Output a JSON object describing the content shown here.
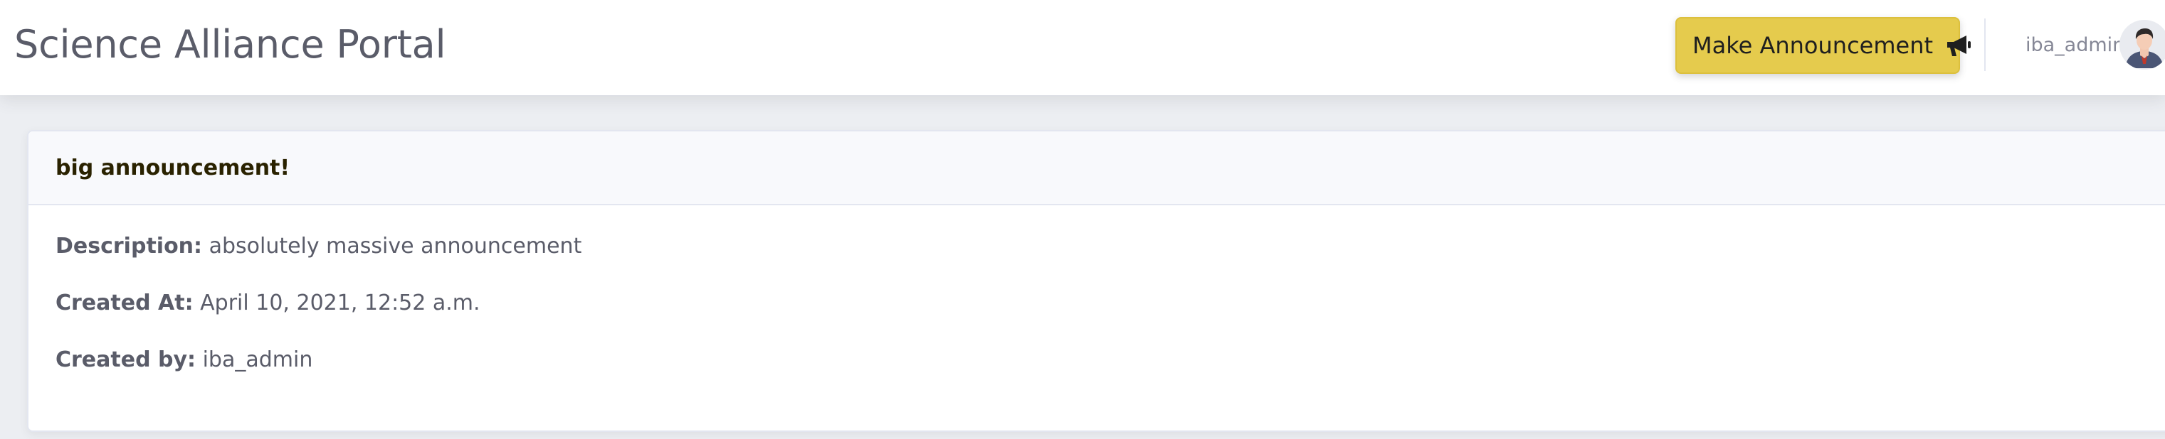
{
  "header": {
    "brand": "Science Alliance Portal",
    "announce_button": {
      "label": "Make Announcement",
      "icon": "megaphone-icon",
      "color": "#e5cb4d"
    },
    "user": {
      "name": "iba_admin",
      "avatar_icon": "avatar-icon"
    }
  },
  "announcement": {
    "title": "big announcement!",
    "fields": [
      {
        "label": "Description:",
        "value": "absolutely massive announcement"
      },
      {
        "label": "Created At:",
        "value": "April 10, 2021, 12:52 a.m."
      },
      {
        "label": "Created by:",
        "value": "iba_admin"
      }
    ]
  }
}
